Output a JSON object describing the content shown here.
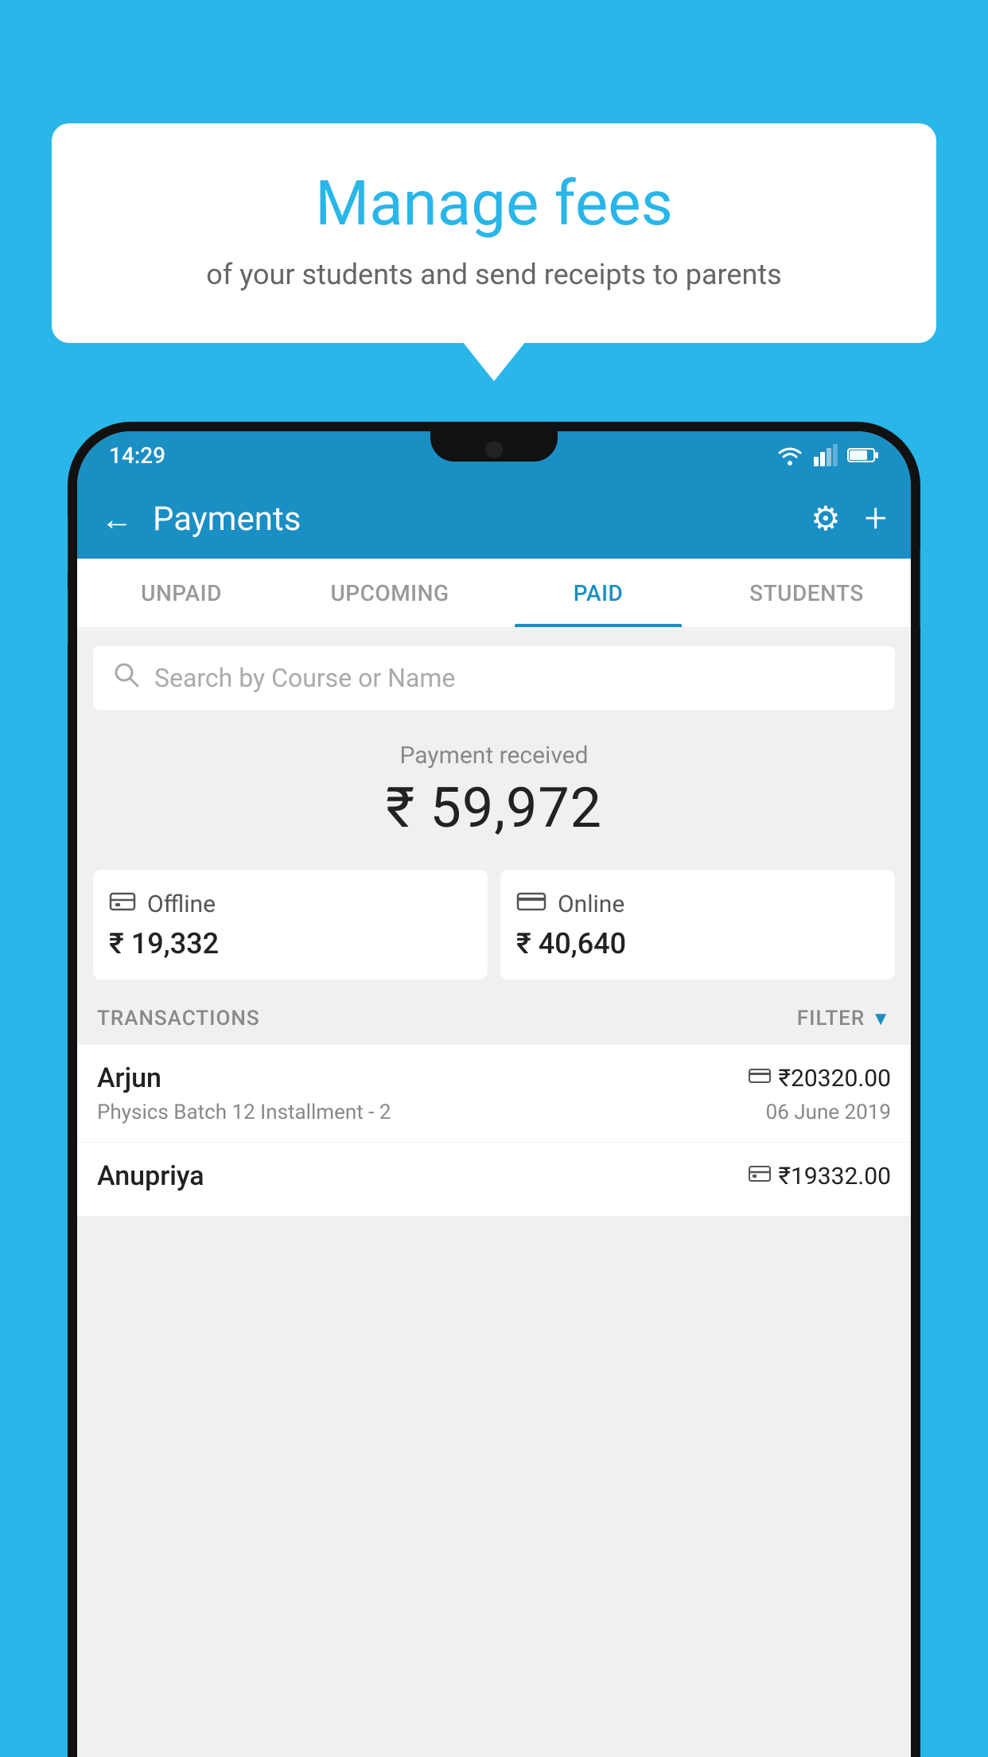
{
  "background_color": "#29b6e8",
  "bubble": {
    "title": "Manage fees",
    "subtitle": "of your students and send receipts to parents"
  },
  "status_bar": {
    "time": "14:29",
    "wifi_icon": "wifi",
    "signal_icon": "signal",
    "battery_icon": "battery"
  },
  "app_bar": {
    "title": "Payments",
    "back_label": "←",
    "gear_label": "⚙",
    "plus_label": "+"
  },
  "tabs": [
    {
      "label": "UNPAID",
      "active": false
    },
    {
      "label": "UPCOMING",
      "active": false
    },
    {
      "label": "PAID",
      "active": true
    },
    {
      "label": "STUDENTS",
      "active": false
    }
  ],
  "search": {
    "placeholder": "Search by Course or Name"
  },
  "payment_received": {
    "label": "Payment received",
    "amount": "₹ 59,972"
  },
  "cards": [
    {
      "icon": "offline",
      "label": "Offline",
      "amount": "₹ 19,332"
    },
    {
      "icon": "online",
      "label": "Online",
      "amount": "₹ 40,640"
    }
  ],
  "transactions_label": "TRANSACTIONS",
  "filter_label": "FILTER",
  "transactions": [
    {
      "name": "Arjun",
      "icon_type": "online",
      "amount": "₹20320.00",
      "course": "Physics Batch 12 Installment - 2",
      "date": "06 June 2019"
    },
    {
      "name": "Anupriya",
      "icon_type": "offline",
      "amount": "₹19332.00",
      "course": "",
      "date": ""
    }
  ]
}
